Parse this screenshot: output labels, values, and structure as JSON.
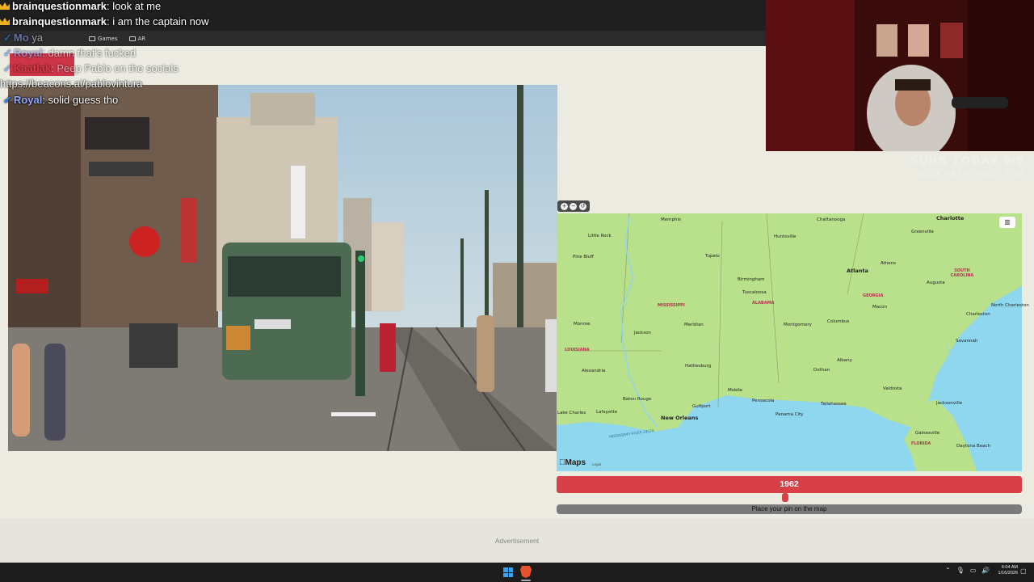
{
  "bookmarks": [
    {
      "icon": "folder-icon",
      "label": "Games"
    },
    {
      "icon": "folder-icon",
      "label": "AR"
    }
  ],
  "chat": {
    "lines": [
      {
        "user": "brainquestionmark",
        "message": ": look at me"
      },
      {
        "user": "brainquestionmark",
        "message": ": i am the captain now"
      },
      {
        "user": "Mo",
        "message": "ya"
      },
      {
        "user": "Royal",
        "message": ": damn that's fucked"
      },
      {
        "user": "Kaatlak",
        "message": ": Peep Pablo on the socials"
      },
      {
        "user": "",
        "message": "https://beacons.ai/pablovintura"
      },
      {
        "user": "Royal",
        "message": ": solid guess tho"
      }
    ]
  },
  "stream": {
    "subs_text": "SUBS TODAY 0/5",
    "follow_text": "GUXYXTY FOLLOW"
  },
  "map": {
    "controls": [
      "zoom-in",
      "zoom-out",
      "reset"
    ],
    "logo": "Maps",
    "legal": "Legal",
    "cities": [
      {
        "name": "Memphis"
      },
      {
        "name": "Chattanooga"
      },
      {
        "name": "Charlotte"
      },
      {
        "name": "Little Rock"
      },
      {
        "name": "Huntsville"
      },
      {
        "name": "Greenville"
      },
      {
        "name": "Pine Bluff"
      },
      {
        "name": "Tupelo"
      },
      {
        "name": "Athens"
      },
      {
        "name": "Atlanta"
      },
      {
        "name": "Birmingham"
      },
      {
        "name": "Tuscaloosa"
      },
      {
        "name": "Augusta"
      },
      {
        "name": "Macon"
      },
      {
        "name": "Charleston"
      },
      {
        "name": "North Charleston"
      },
      {
        "name": "Monroe"
      },
      {
        "name": "Meridian"
      },
      {
        "name": "Montgomery"
      },
      {
        "name": "Columbus"
      },
      {
        "name": "Jackson"
      },
      {
        "name": "Savannah"
      },
      {
        "name": "Albany"
      },
      {
        "name": "Alexandria"
      },
      {
        "name": "Hattiesburg"
      },
      {
        "name": "Dothan"
      },
      {
        "name": "Valdosta"
      },
      {
        "name": "Mobile"
      },
      {
        "name": "Baton Rouge"
      },
      {
        "name": "Pensacola"
      },
      {
        "name": "Tallahassee"
      },
      {
        "name": "Jacksonville"
      },
      {
        "name": "Gulfport"
      },
      {
        "name": "Lafayette"
      },
      {
        "name": "Lake Charles"
      },
      {
        "name": "Panama City"
      },
      {
        "name": "New Orleans"
      },
      {
        "name": "Gainesville"
      },
      {
        "name": "Daytona Beach"
      }
    ],
    "states": [
      "MISSISSIPPI",
      "ALABAMA",
      "GEORGIA",
      "SOUTH CAROLINA",
      "LOUISIANA",
      "FLORIDA"
    ],
    "water_label": "MISSISSIPPI RIVER DELTA"
  },
  "year_bar": {
    "label": "1962"
  },
  "place_button": {
    "label": "Place your pin on the map"
  },
  "ad": {
    "label": "Advertisement"
  },
  "taskbar": {
    "time": "6:04 AM",
    "date": "1/16/2026"
  },
  "colors": {
    "year_bar": "#d84048",
    "map_water": "#8fd6ef",
    "map_land": "#b9e08a"
  }
}
